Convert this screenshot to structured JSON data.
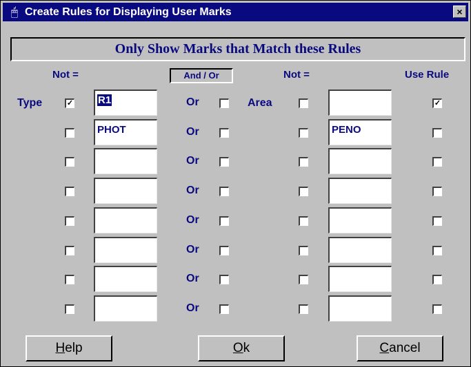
{
  "window": {
    "title": "Create Rules for Displaying User Marks",
    "title_icon": "mouse-icon",
    "close_glyph": "×"
  },
  "banner": "Only Show Marks that Match these Rules",
  "headers": {
    "not_left": "Not =",
    "and_or": "And / Or",
    "not_right": "Not =",
    "use_rule": "Use Rule"
  },
  "row_labels": {
    "type": "Type",
    "area": "Area"
  },
  "rows": [
    {
      "type_not": true,
      "type_value": "R1",
      "type_selected": true,
      "andor": "Or",
      "andor_checked": false,
      "area_not": false,
      "area_value": "",
      "use_rule": true
    },
    {
      "type_not": false,
      "type_value": "PHOT",
      "andor": "Or",
      "andor_checked": false,
      "area_not": false,
      "area_value": "PENO",
      "use_rule": false
    },
    {
      "type_not": false,
      "type_value": "",
      "andor": "Or",
      "andor_checked": false,
      "area_not": false,
      "area_value": "",
      "use_rule": false
    },
    {
      "type_not": false,
      "type_value": "",
      "andor": "Or",
      "andor_checked": false,
      "area_not": false,
      "area_value": "",
      "use_rule": false
    },
    {
      "type_not": false,
      "type_value": "",
      "andor": "Or",
      "andor_checked": false,
      "area_not": false,
      "area_value": "",
      "use_rule": false
    },
    {
      "type_not": false,
      "type_value": "",
      "andor": "Or",
      "andor_checked": false,
      "area_not": false,
      "area_value": "",
      "use_rule": false
    },
    {
      "type_not": false,
      "type_value": "",
      "andor": "Or",
      "andor_checked": false,
      "area_not": false,
      "area_value": "",
      "use_rule": false
    },
    {
      "type_not": false,
      "type_value": "",
      "andor": "Or",
      "andor_checked": false,
      "area_not": false,
      "area_value": "",
      "use_rule": false
    }
  ],
  "buttons": {
    "help": {
      "mnemonic": "H",
      "rest": "elp"
    },
    "ok": {
      "mnemonic": "O",
      "rest": "k"
    },
    "cancel": {
      "mnemonic": "C",
      "rest": "ancel"
    }
  },
  "colors": {
    "title_bar": "#0a0a80",
    "face": "#c0c0c0",
    "label_text": "#0a0a80"
  }
}
